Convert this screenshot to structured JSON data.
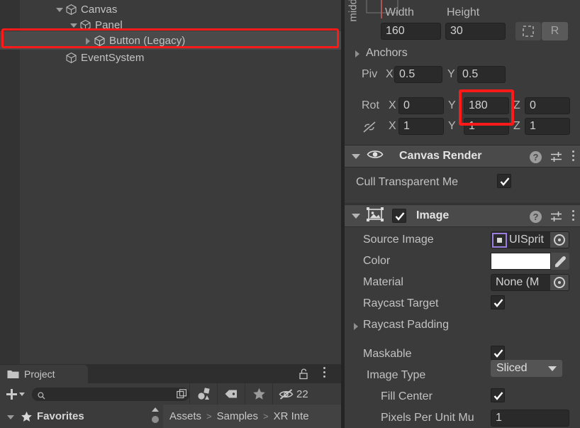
{
  "hierarchy": {
    "items": [
      {
        "label": "Canvas",
        "indent": 0,
        "expander": "down",
        "selected": false
      },
      {
        "label": "Panel",
        "indent": 1,
        "expander": "down",
        "selected": false
      },
      {
        "label": "Button (Legacy)",
        "indent": 2,
        "expander": "right",
        "selected": true
      },
      {
        "label": "EventSystem",
        "indent": 1,
        "expander": "none",
        "selected": false
      }
    ]
  },
  "project": {
    "tab_label": "Project",
    "lock_icon": "lock-open-icon",
    "menu_icon": "kebab-menu-icon",
    "add_label": "+",
    "search_placeholder": "",
    "search_value": "",
    "search_icon": "search-icon",
    "save_search_icon": "save-search-icon",
    "filter_type_icon": "filter-by-type-icon",
    "filter_label_icon": "filter-by-label-icon",
    "filter_favorite_icon": "filter-favorite-star-icon",
    "hidden_icon": "hidden-eye-icon",
    "hidden_count": "22",
    "favorites_label": "Favorites",
    "favorites_star_icon": "star-icon",
    "breadcrumb": [
      "Assets",
      "Samples",
      "XR Inte"
    ],
    "breadcrumb_sep": ">"
  },
  "inspector": {
    "rect_transform": {
      "anchor_preset_label": "middle",
      "width_label": "Width",
      "width_value": "160",
      "height_label": "Height",
      "height_value": "30",
      "blueprint_icon": "blueprint-mode-icon",
      "raw_edit_label": "R",
      "anchors_label": "Anchors",
      "pivot_label": "Piv",
      "pivot_x_axis": "X",
      "pivot_x_value": "0.5",
      "pivot_y_axis": "Y",
      "pivot_y_value": "0.5",
      "rotation_label": "Rot",
      "rot_x_axis": "X",
      "rot_x_value": "0",
      "rot_y_axis": "Y",
      "rot_y_value": "180",
      "rot_z_axis": "Z",
      "rot_z_value": "0",
      "scale_icon": "constrain-proportions-off-icon",
      "scale_x_axis": "X",
      "scale_x_value": "1",
      "scale_y_axis": "Y",
      "scale_y_value": "1",
      "scale_z_axis": "Z",
      "scale_z_value": "1"
    },
    "canvas_renderer": {
      "title": "Canvas Render",
      "visibility_icon": "eye-icon",
      "help_icon": "help-icon",
      "preset_icon": "preset-sliders-icon",
      "menu_icon": "kebab-menu-icon",
      "cull_label": "Cull Transparent Me",
      "cull_checked": true
    },
    "image": {
      "title": "Image",
      "component_icon": "image-component-icon",
      "enabled": true,
      "help_icon": "help-icon",
      "preset_icon": "preset-sliders-icon",
      "menu_icon": "kebab-menu-icon",
      "source_image_label": "Source Image",
      "source_image_value": "UISprit",
      "source_image_thumb": "sprite-icon",
      "color_label": "Color",
      "color_value": "#ffffff",
      "eyedropper_icon": "eyedropper-icon",
      "material_label": "Material",
      "material_value": "None (M",
      "raycast_target_label": "Raycast Target",
      "raycast_target_checked": true,
      "raycast_padding_label": "Raycast Padding",
      "maskable_label": "Maskable",
      "maskable_checked": true,
      "image_type_label": "Image Type",
      "image_type_value": "Sliced",
      "fill_center_label": "Fill Center",
      "fill_center_checked": true,
      "ppu_label": "Pixels Per Unit Mu",
      "ppu_value": "1"
    }
  },
  "annotations": {
    "hierarchy_highlight_color": "#ff1a1a",
    "rotation_highlight_color": "#ff1a1a"
  }
}
